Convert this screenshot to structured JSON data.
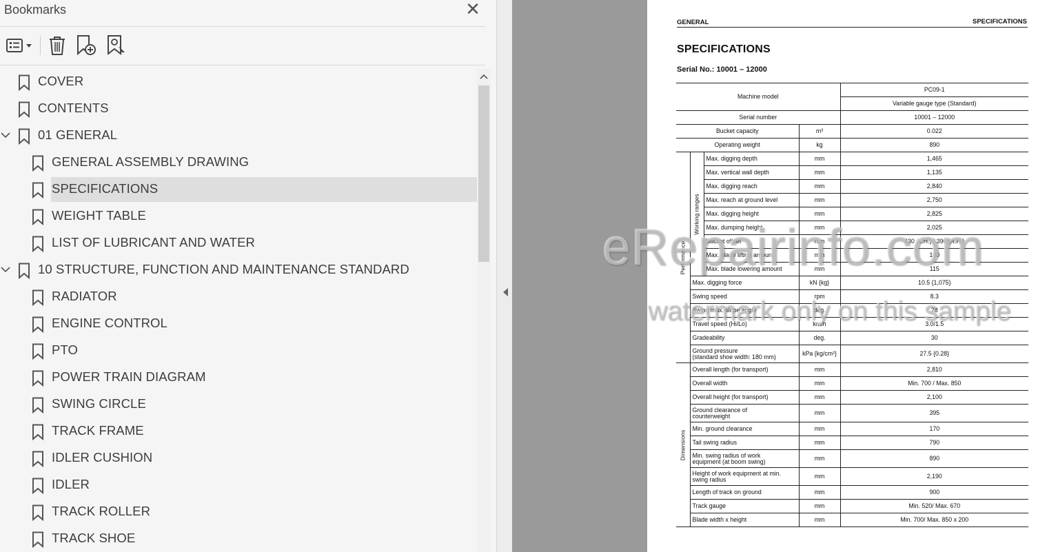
{
  "bookmarks_panel": {
    "title": "Bookmarks",
    "items": [
      {
        "label": "COVER",
        "level": 0,
        "expanded": null,
        "selected": false
      },
      {
        "label": "CONTENTS",
        "level": 0,
        "expanded": null,
        "selected": false
      },
      {
        "label": "01 GENERAL",
        "level": 0,
        "expanded": true,
        "selected": false
      },
      {
        "label": "GENERAL ASSEMBLY DRAWING",
        "level": 1,
        "expanded": null,
        "selected": false
      },
      {
        "label": "SPECIFICATIONS",
        "level": 1,
        "expanded": null,
        "selected": true
      },
      {
        "label": "WEIGHT TABLE",
        "level": 1,
        "expanded": null,
        "selected": false
      },
      {
        "label": "LIST OF LUBRICANT AND WATER",
        "level": 1,
        "expanded": null,
        "selected": false
      },
      {
        "label": "10 STRUCTURE, FUNCTION AND MAINTENANCE STANDARD",
        "level": 0,
        "expanded": true,
        "selected": false
      },
      {
        "label": "RADIATOR",
        "level": 1,
        "expanded": null,
        "selected": false
      },
      {
        "label": "ENGINE CONTROL",
        "level": 1,
        "expanded": null,
        "selected": false
      },
      {
        "label": "PTO",
        "level": 1,
        "expanded": null,
        "selected": false
      },
      {
        "label": "POWER TRAIN DIAGRAM",
        "level": 1,
        "expanded": null,
        "selected": false
      },
      {
        "label": "SWING CIRCLE",
        "level": 1,
        "expanded": null,
        "selected": false
      },
      {
        "label": "TRACK FRAME",
        "level": 1,
        "expanded": null,
        "selected": false
      },
      {
        "label": "IDLER CUSHION",
        "level": 1,
        "expanded": null,
        "selected": false
      },
      {
        "label": "IDLER",
        "level": 1,
        "expanded": null,
        "selected": false
      },
      {
        "label": "TRACK ROLLER",
        "level": 1,
        "expanded": null,
        "selected": false
      },
      {
        "label": "TRACK SHOE",
        "level": 1,
        "expanded": null,
        "selected": false
      }
    ]
  },
  "document": {
    "header_left": "GENERAL",
    "header_right": "SPECIFICATIONS",
    "title": "SPECIFICATIONS",
    "serial_line": "Serial No.: 10001 – 12000",
    "table": {
      "machine_model_label": "Machine model",
      "model_value": "PC09-1",
      "gauge_type": "Variable gauge type (Standard)",
      "serial_label": "Serial number",
      "serial_value": "10001 – 12000",
      "bucket_capacity": {
        "item": "Bucket capacity",
        "unit": "m³",
        "value": "0.022"
      },
      "operating_weight": {
        "item": "Operating weight",
        "unit": "kg",
        "value": "890"
      },
      "performance_label": "Performance",
      "working_ranges_label": "Working ranges",
      "working_ranges": [
        {
          "item": "Max. digging depth",
          "unit": "mm",
          "value": "1,465"
        },
        {
          "item": "Max. vertical wall depth",
          "unit": "mm",
          "value": "1,135"
        },
        {
          "item": "Max. digging reach",
          "unit": "mm",
          "value": "2,840"
        },
        {
          "item": "Max. reach at ground level",
          "unit": "mm",
          "value": "2,750"
        },
        {
          "item": "Max. digging height",
          "unit": "mm",
          "value": "2,825"
        },
        {
          "item": "Max. dumping height",
          "unit": "mm",
          "value": "2,025"
        },
        {
          "item": "Bucket offset",
          "unit": "mm",
          "value": "430 (L.H.) / 390 (R.H.)"
        },
        {
          "item": "Max. blade lifting amount",
          "unit": "mm",
          "value": "180"
        },
        {
          "item": "Max. blade lowering amount",
          "unit": "mm",
          "value": "115"
        }
      ],
      "performance_other": [
        {
          "item": "Max. digging force",
          "unit": "kN {kg}",
          "value": "10.5 {1,075}"
        },
        {
          "item": "Swing speed",
          "unit": "rpm",
          "value": "8.3"
        },
        {
          "item": "Swing max. slope angle",
          "unit": "deg.",
          "value": "28"
        },
        {
          "item": "Travel speed (Hi/Lo)",
          "unit": "km/h",
          "value": "3.0/1.5"
        },
        {
          "item": "Gradeability",
          "unit": "deg.",
          "value": "30"
        },
        {
          "item": "Ground pressure",
          "item2": "(standard shoe width: 180 mm)",
          "unit": "kPa {kg/cm²}",
          "value": "27.5 {0.28}"
        }
      ],
      "dimensions_label": "Dimensions",
      "dimensions": [
        {
          "item": "Overall length (for transport)",
          "unit": "mm",
          "value": "2,810"
        },
        {
          "item": "Overall width",
          "unit": "mm",
          "value": "Min. 700 / Max. 850"
        },
        {
          "item": "Overall height (for transport)",
          "unit": "mm",
          "value": "2,100"
        },
        {
          "item": "Ground clearance of",
          "item2": "counterweight",
          "unit": "mm",
          "value": "395"
        },
        {
          "item": "Min. ground clearance",
          "unit": "mm",
          "value": "170"
        },
        {
          "item": "Tail swing radius",
          "unit": "mm",
          "value": "790"
        },
        {
          "item": "Min. swing radius of work",
          "item2": "equipment (at boom swing)",
          "unit": "mm",
          "value": "890"
        },
        {
          "item": "Height of work equipment at min.",
          "item2": "swing radius",
          "unit": "mm",
          "value": "2,190"
        },
        {
          "item": "Length of track on ground",
          "unit": "mm",
          "value": "900"
        },
        {
          "item": "Track gauge",
          "unit": "mm",
          "value": "Min. 520/ Max. 670"
        },
        {
          "item": "Blade width x height",
          "unit": "mm",
          "value": "Min. 700/ Max. 850 x 200"
        }
      ]
    }
  },
  "watermark": {
    "line1": "eRepairinfo.com",
    "line2": "watermark only on this sample"
  },
  "icons": [
    "close-icon",
    "options-icon",
    "delete-bookmark-icon",
    "new-bookmark-icon",
    "find-bookmark-icon",
    "chevron-down-icon",
    "bookmark-icon",
    "scroll-up-icon",
    "collapse-panel-icon"
  ],
  "colors": {
    "panel_bg": "#f5f5f5",
    "selected_bg": "#dedede",
    "doc_gray": "#9a9a9a"
  }
}
